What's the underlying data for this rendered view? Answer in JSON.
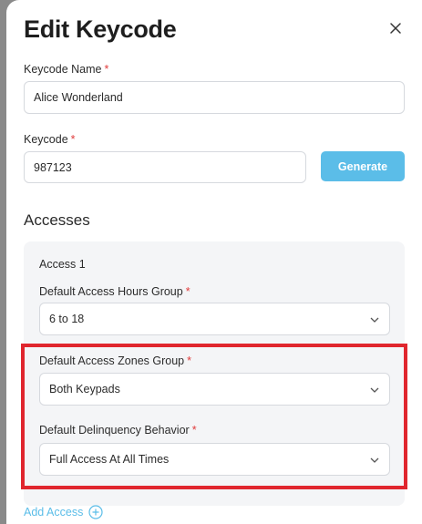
{
  "modal": {
    "title": "Edit Keycode"
  },
  "fields": {
    "keycode_name": {
      "label": "Keycode Name",
      "required_mark": "*",
      "value": "Alice Wonderland"
    },
    "keycode": {
      "label": "Keycode",
      "required_mark": "*",
      "value": "987123"
    },
    "generate_label": "Generate"
  },
  "accesses": {
    "title": "Accesses",
    "items": [
      {
        "label": "Access 1",
        "hours_group": {
          "label": "Default Access Hours Group",
          "required_mark": "*",
          "value": "6 to 18"
        },
        "zones_group": {
          "label": "Default Access Zones Group",
          "required_mark": "*",
          "value": "Both Keypads"
        },
        "delinquency": {
          "label": "Default Delinquency Behavior",
          "required_mark": "*",
          "value": "Full Access At All Times"
        }
      }
    ],
    "add_label": "Add Access"
  },
  "colors": {
    "accent": "#5bbde8",
    "required": "#e03b3b",
    "highlight": "#e0262e",
    "card_bg": "#f4f5f7"
  },
  "icons": {
    "close": "close-icon",
    "chevron": "chevron-down-icon",
    "add": "plus-circle-icon"
  }
}
